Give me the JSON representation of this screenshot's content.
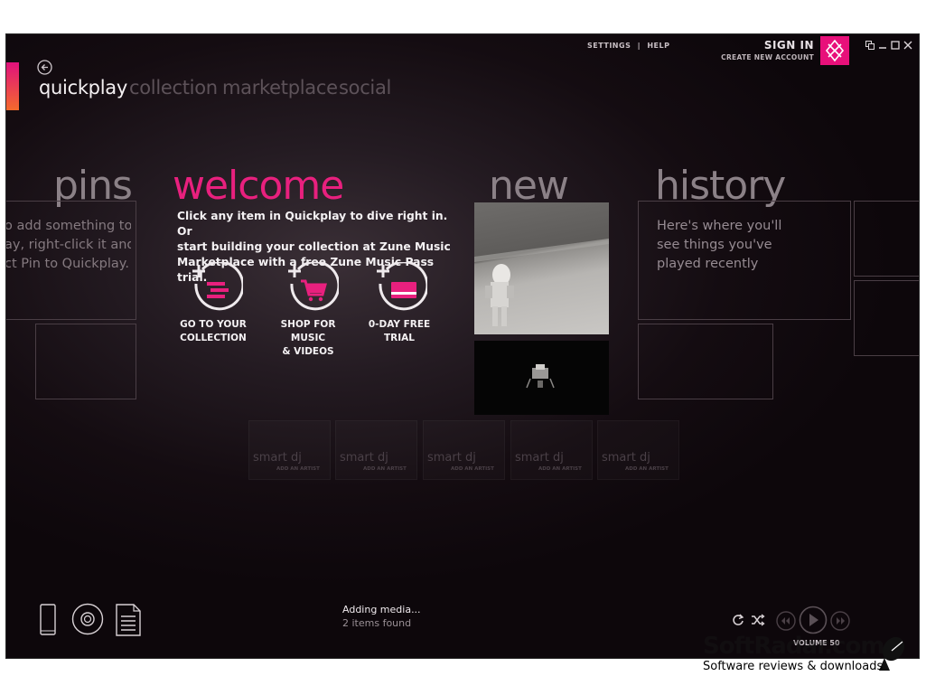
{
  "app": {
    "top_links": {
      "settings": "SETTINGS",
      "separator": "|",
      "help": "HELP"
    },
    "account": {
      "sign_in": "SIGN IN",
      "create": "CREATE NEW ACCOUNT"
    },
    "colors": {
      "accent": "#e8207e",
      "logo": "#e8107a",
      "background": "#140c11"
    }
  },
  "nav": {
    "tabs": [
      "quickplay",
      "collection",
      "marketplace",
      "social"
    ],
    "active": "quickplay"
  },
  "pins": {
    "heading": "pins",
    "lines": [
      "o add something to",
      "ay, right-click it and",
      "ct Pin to Quickplay."
    ]
  },
  "welcome": {
    "heading": "welcome",
    "lines": [
      "Click any item in Quickplay to dive right in. Or",
      "start building your collection at Zune Music",
      "Marketplace with a free Zune Music Pass trial."
    ],
    "actions": [
      {
        "line1": "GO TO YOUR",
        "line2": "COLLECTION",
        "icon": "collection-icon"
      },
      {
        "line1": "SHOP FOR MUSIC",
        "line2": "& VIDEOS",
        "icon": "cart-icon"
      },
      {
        "line1": "0-DAY FREE",
        "line2": "TRIAL",
        "icon": "card-icon"
      }
    ]
  },
  "new": {
    "heading": "new"
  },
  "history": {
    "heading": "history",
    "lines": [
      "Here's where you'll",
      "see things you've",
      "played recently"
    ]
  },
  "smart_dj": {
    "label": "smart dj",
    "sub": "ADD AN ARTIST",
    "count": 5
  },
  "status": {
    "line1": "Adding media...",
    "line2": "2 items found"
  },
  "player": {
    "volume": "VOLUME 50"
  },
  "watermark": {
    "brand": "SoftRadar.com",
    "tagline": "Software reviews & downloads"
  }
}
